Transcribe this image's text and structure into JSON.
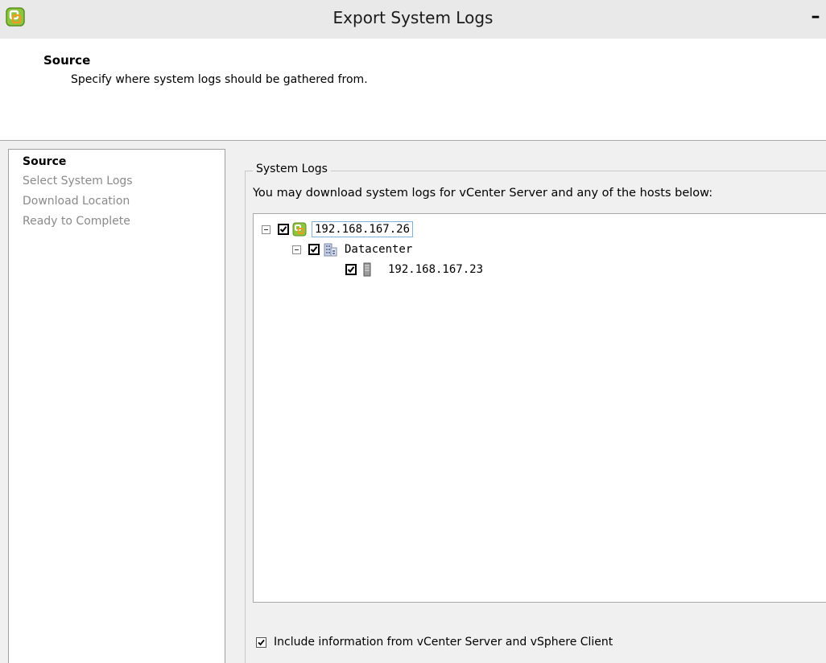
{
  "window": {
    "title": "Export System Logs",
    "minimize_glyph": "–",
    "app_icon": "vsphere-logo-icon"
  },
  "header": {
    "title": "Source",
    "description": "Specify where system logs should be gathered from."
  },
  "nav": {
    "items": [
      {
        "label": "Source",
        "active": true
      },
      {
        "label": "Select System Logs",
        "active": false
      },
      {
        "label": "Download Location",
        "active": false
      },
      {
        "label": "Ready to Complete",
        "active": false
      }
    ]
  },
  "system_logs": {
    "group_label": "System Logs",
    "description": "You may download system logs for vCenter Server and any of the hosts below:",
    "tree": [
      {
        "label": "192.168.167.26",
        "icon": "vcenter-icon",
        "checked": true,
        "expanded": true,
        "level": 0,
        "selected": true
      },
      {
        "label": "Datacenter",
        "icon": "datacenter-icon",
        "checked": true,
        "expanded": true,
        "level": 1,
        "selected": false
      },
      {
        "label": "192.168.167.23",
        "icon": "host-icon",
        "checked": true,
        "expanded": false,
        "level": 2,
        "selected": false
      }
    ]
  },
  "include_info": {
    "label": "Include information from vCenter Server and vSphere Client",
    "checked": true
  },
  "colors": {
    "vsphere_green": "#8cc63f",
    "vsphere_orange": "#f29a1f",
    "border": "#a0a0a0",
    "disabled_text": "#8a8a8a"
  }
}
